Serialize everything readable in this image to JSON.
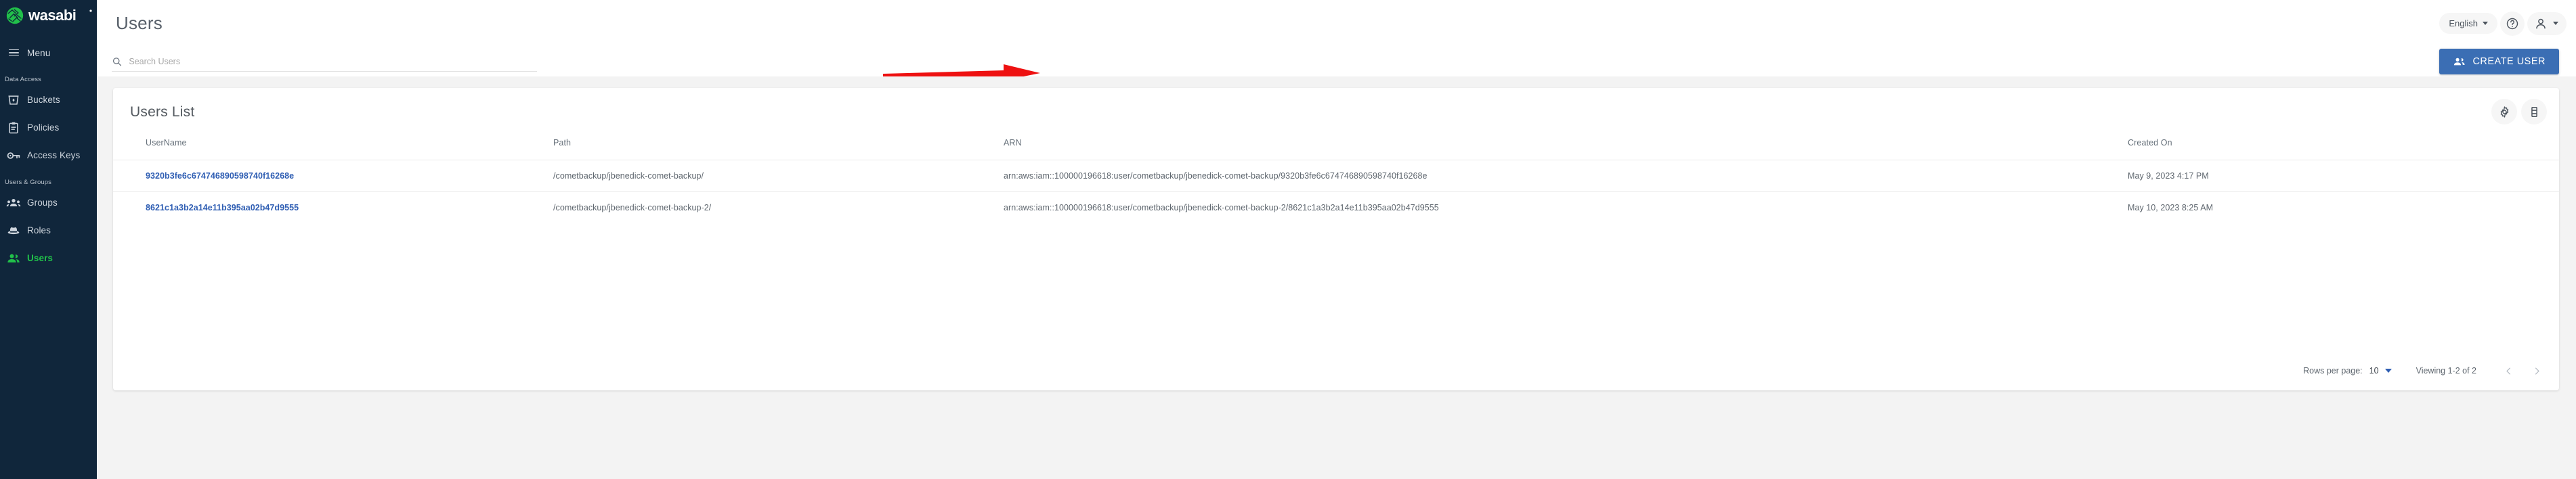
{
  "brand": {
    "name": "wasabi",
    "logo_icon": "wasabi-logo-icon",
    "accent": "#21c04a",
    "sidebar_bg": "#10263b"
  },
  "sidebar": {
    "menu_label": "Menu",
    "menu_icon": "hamburger-menu-icon",
    "sections": [
      {
        "label": "Data Access",
        "items": [
          {
            "label": "Buckets",
            "icon": "bucket-icon",
            "active": false
          },
          {
            "label": "Policies",
            "icon": "clipboard-icon",
            "active": false
          },
          {
            "label": "Access Keys",
            "icon": "key-icon",
            "active": false
          }
        ]
      },
      {
        "label": "Users & Groups",
        "items": [
          {
            "label": "Groups",
            "icon": "groups-icon",
            "active": false
          },
          {
            "label": "Roles",
            "icon": "hat-icon",
            "active": false
          },
          {
            "label": "Users",
            "icon": "users-icon",
            "active": true
          }
        ]
      }
    ]
  },
  "header": {
    "title": "Users",
    "language": {
      "label": "English",
      "caret_icon": "chevron-down-icon"
    },
    "help_icon": "help-circle-icon",
    "account": {
      "icon": "person-icon",
      "caret_icon": "chevron-down-icon"
    }
  },
  "search": {
    "placeholder": "Search Users",
    "value": "",
    "icon": "search-icon"
  },
  "actions": {
    "create_user": {
      "label": "CREATE USER",
      "icon": "person-add-icon",
      "color": "#3b6eb4"
    },
    "annotation_arrow": {
      "color": "#ee1111",
      "points_to": "CREATE USER"
    }
  },
  "card": {
    "title": "Users List",
    "header_icons": [
      {
        "name": "settings-gear-icon"
      },
      {
        "name": "column-view-icon"
      }
    ],
    "columns": [
      "UserName",
      "Path",
      "ARN",
      "Created On"
    ],
    "rows": [
      {
        "username": "9320b3fe6c674746890598740f16268e",
        "path": "/cometbackup/jbenedick-comet-backup/",
        "arn": "arn:aws:iam::100000196618:user/cometbackup/jbenedick-comet-backup/9320b3fe6c674746890598740f16268e",
        "created_on": "May 9, 2023 4:17 PM"
      },
      {
        "username": "8621c1a3b2a14e11b395aa02b47d9555",
        "path": "/cometbackup/jbenedick-comet-backup-2/",
        "arn": "arn:aws:iam::100000196618:user/cometbackup/jbenedick-comet-backup-2/8621c1a3b2a14e11b395aa02b47d9555",
        "created_on": "May 10, 2023 8:25 AM"
      }
    ],
    "footer": {
      "rows_per_page_label": "Rows per page:",
      "rows_per_page_value": "10",
      "viewing": "Viewing 1-2 of 2",
      "prev_icon": "chevron-left-icon",
      "next_icon": "chevron-right-icon"
    }
  }
}
